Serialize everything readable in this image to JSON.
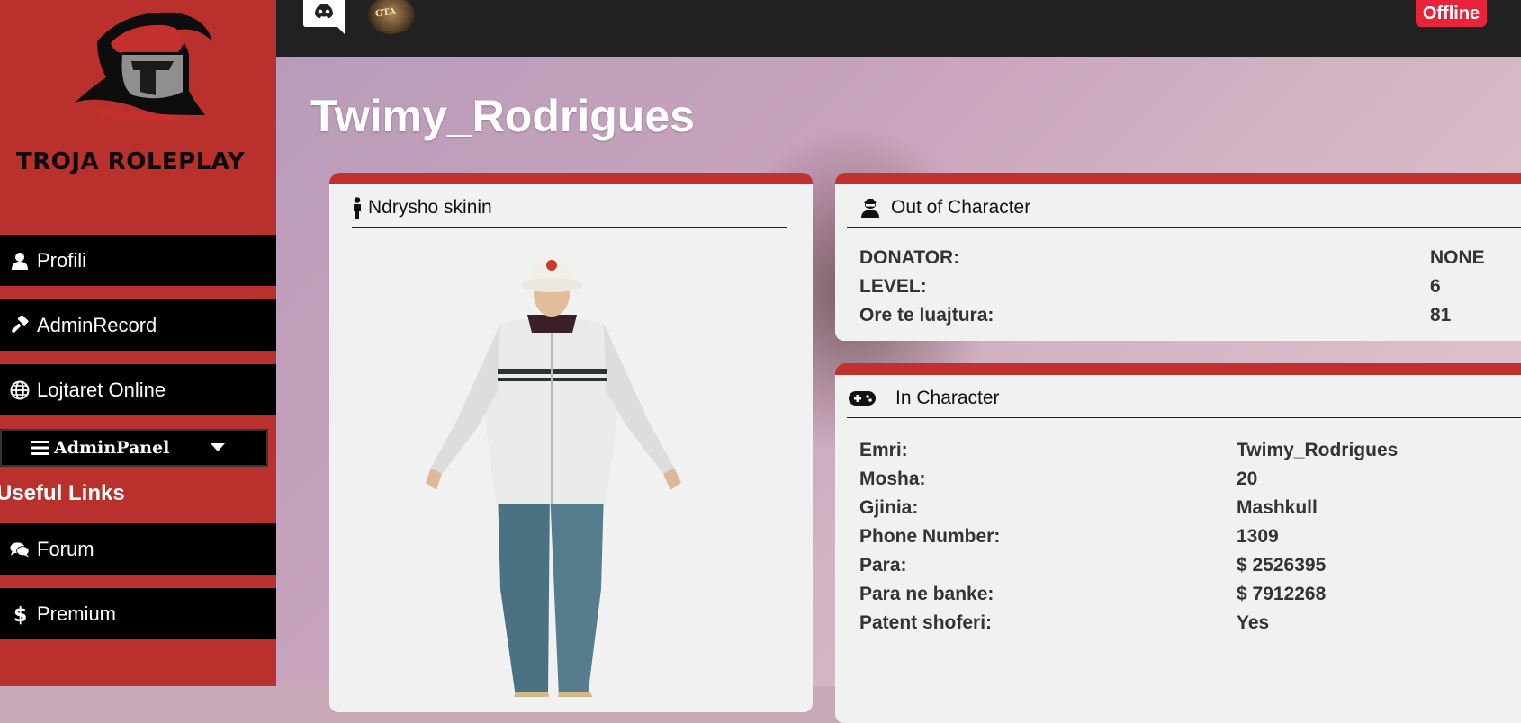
{
  "sidebar": {
    "brand": "TROJA ROLEPLAY",
    "nav": [
      {
        "label": "Profili",
        "icon": "user-icon"
      },
      {
        "label": "AdminRecord",
        "icon": "gavel-icon"
      },
      {
        "label": "Lojtaret Online",
        "icon": "globe-icon"
      }
    ],
    "admin_panel": {
      "label": "AdminPanel",
      "icon": "bars-icon"
    },
    "useful_links_title": "Useful Links",
    "links": [
      {
        "label": "Forum",
        "icon": "comments-icon"
      },
      {
        "label": "Premium",
        "icon": "dollar-icon"
      }
    ]
  },
  "topbar": {
    "discord_icon": "discord-icon",
    "gta_icon_text": "GTA",
    "status": "Offline",
    "status_color": "#e8243a"
  },
  "profile": {
    "player_name": "Twimy_Rodrigues"
  },
  "skin_card": {
    "title": "Ndrysho skinin",
    "icon": "person-icon"
  },
  "ooc_card": {
    "title": "Out of Character",
    "icon": "user-secret-icon",
    "labels": [
      "DONATOR:",
      "LEVEL:",
      "Ore te luajtura:"
    ],
    "values": [
      "NONE",
      "6",
      "81"
    ]
  },
  "ic_card": {
    "title": "In Character",
    "icon": "gamepad-icon",
    "labels": [
      "Emri:",
      "Mosha:",
      "Gjinia:",
      "Phone Number:",
      "Para:",
      "Para ne banke:",
      "Patent shoferi:"
    ],
    "values": [
      "Twimy_Rodrigues",
      "20",
      "Mashkull",
      "1309",
      "$ 2526395",
      "$ 7912268",
      "Yes"
    ]
  },
  "colors": {
    "sidebar": "#b9302c",
    "card_accent": "#c1312d",
    "topbar": "#212121"
  }
}
